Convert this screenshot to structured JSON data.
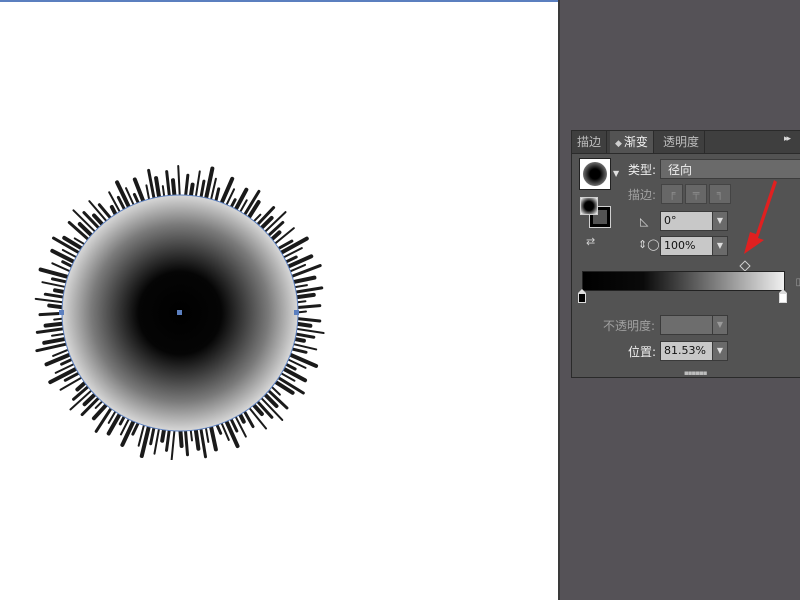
{
  "panel": {
    "tabs": [
      {
        "label": "描边"
      },
      {
        "label": "渐变"
      },
      {
        "label": "透明度"
      }
    ],
    "menu_glyph": "▸▸",
    "type_label": "类型:",
    "type_value": "径向",
    "stroke_label": "描边:",
    "angle_value": "0°",
    "aspect_ratio_value": "100%",
    "opacity_label": "不透明度:",
    "opacity_value": "",
    "location_label": "位置:",
    "location_value": "81.53%",
    "gradient_stops": [
      {
        "color": "#000000",
        "location": 0
      },
      {
        "color": "#ffffff",
        "location": 100
      }
    ],
    "midpoint_location": 81.53
  },
  "artwork": {
    "shape": "radial-gradient circle with roughened spiky edge",
    "gradient_center_color": "#000000",
    "gradient_edge_color": "#ffffff",
    "selection_color": "#5b7fbf"
  },
  "colors": {
    "canvas": "#ffffff",
    "pasteboard": "#555257",
    "panel_bg": "#535353",
    "annotation_arrow": "#e02020"
  }
}
